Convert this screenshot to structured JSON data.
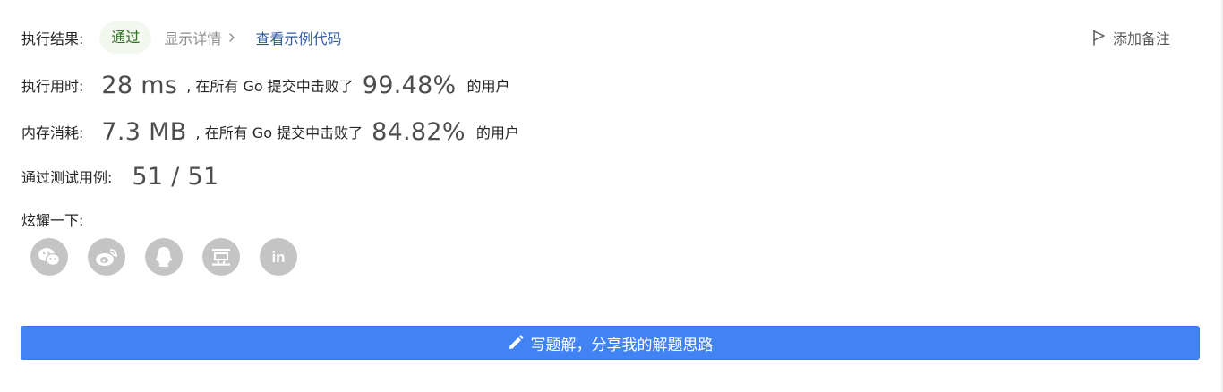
{
  "result": {
    "label": "执行结果:",
    "status": "通过",
    "details_link": "显示详情",
    "example_link": "查看示例代码"
  },
  "note": {
    "label": "添加备注"
  },
  "runtime": {
    "label": "执行用时:",
    "value": "28 ms",
    "mid_text": ", 在所有 Go 提交中击败了",
    "percent": "99.48%",
    "suffix": "的用户"
  },
  "memory": {
    "label": "内存消耗:",
    "value": "7.3 MB",
    "mid_text": ", 在所有 Go 提交中击败了",
    "percent": "84.82%",
    "suffix": "的用户"
  },
  "tests": {
    "label": "通过测试用例:",
    "value": "51 / 51"
  },
  "share": {
    "label": "炫耀一下:",
    "icons": [
      "wechat-icon",
      "weibo-icon",
      "qq-icon",
      "douban-icon",
      "linkedin-icon"
    ],
    "linkedin_text": "in"
  },
  "write_button": {
    "label": "写题解，分享我的解题思路"
  },
  "colors": {
    "accent_blue": "#4283f4",
    "pass_green": "#2b6e1e",
    "pass_bg": "#f2f7ef",
    "link_blue": "#2e5aa7",
    "icon_gray": "#c4c4c4"
  }
}
